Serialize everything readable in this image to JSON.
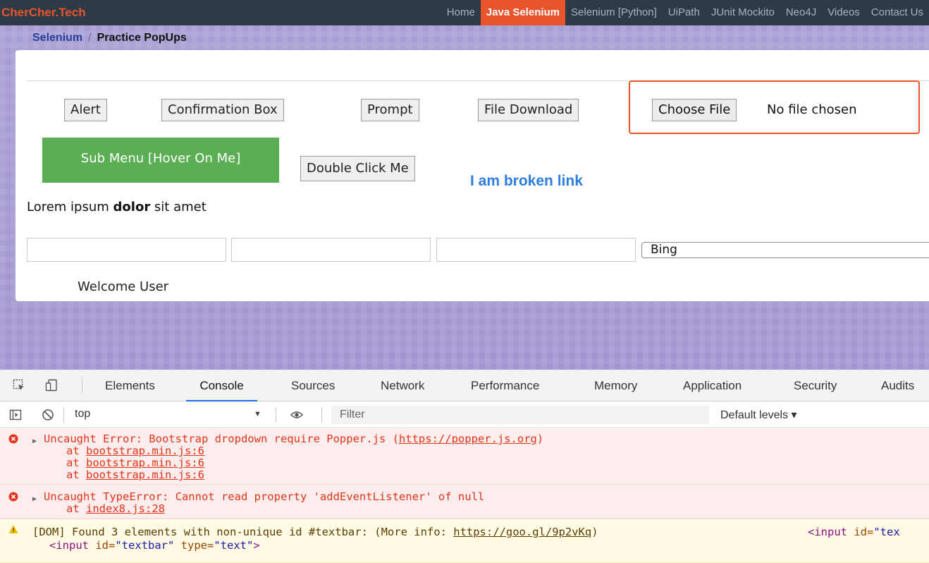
{
  "nav": {
    "brand": "CherCher.Tech",
    "links": [
      "Home",
      "Java Selenium",
      "Selenium [Python]",
      "UiPath",
      "JUnit Mockito",
      "Neo4J",
      "Videos",
      "Contact Us"
    ]
  },
  "breadcrumb": {
    "parent": "Selenium",
    "separator": "/",
    "current": "Practice PopUps"
  },
  "buttons": {
    "alert": "Alert",
    "confirm": "Confirmation Box",
    "prompt": "Prompt",
    "download": "File Download",
    "choose_file": "Choose File",
    "file_status": "No file chosen",
    "submenu": "Sub Menu [Hover On Me]",
    "double_click": "Double Click Me"
  },
  "broken_link": "I am broken link",
  "lorem": {
    "before": "Lorem ipsum ",
    "bold": "dolor",
    "after": " sit amet"
  },
  "select": {
    "value": "Bing"
  },
  "welcome": "Welcome User",
  "devtools": {
    "tabs": [
      "Elements",
      "Console",
      "Sources",
      "Network",
      "Performance",
      "Memory",
      "Application",
      "Security",
      "Audits"
    ],
    "active_tab": "Console",
    "context": "top",
    "filter_placeholder": "Filter",
    "levels": "Default levels ▾",
    "logs": {
      "e1_msg": "Uncaught Error: Bootstrap dropdown require Popper.js (",
      "e1_link": "https://popper.js.org",
      "e1_end": ")",
      "e1_at": "at ",
      "e1_f1": "bootstrap.min.js:6",
      "e1_f2": "bootstrap.min.js:6",
      "e1_f3": "bootstrap.min.js:6",
      "e2_msg": "Uncaught TypeError: Cannot read property 'addEventListener' of null",
      "e2_f1": "index8.js:28",
      "w_msg": "[DOM] Found 3 elements with non-unique id #textbar: (More info: ",
      "w_link": "https://goo.gl/9p2vKq",
      "w_end": ")",
      "w_tail_tag": "<input",
      "w_tail_attr": " id=",
      "w_tail_val": "\"tex",
      "w2_tag_open": "<input",
      "w2_attr1": " id=",
      "w2_val1": "\"textbar\"",
      "w2_attr2": " type=",
      "w2_val2": "\"text\"",
      "w2_tag_close": ">"
    }
  },
  "colors": {
    "accent": "#e8542c",
    "nav_bg": "#2f3a47",
    "submenu_green": "#5cae55",
    "link_blue": "#2d7ee0",
    "error_red": "#e3341b"
  }
}
